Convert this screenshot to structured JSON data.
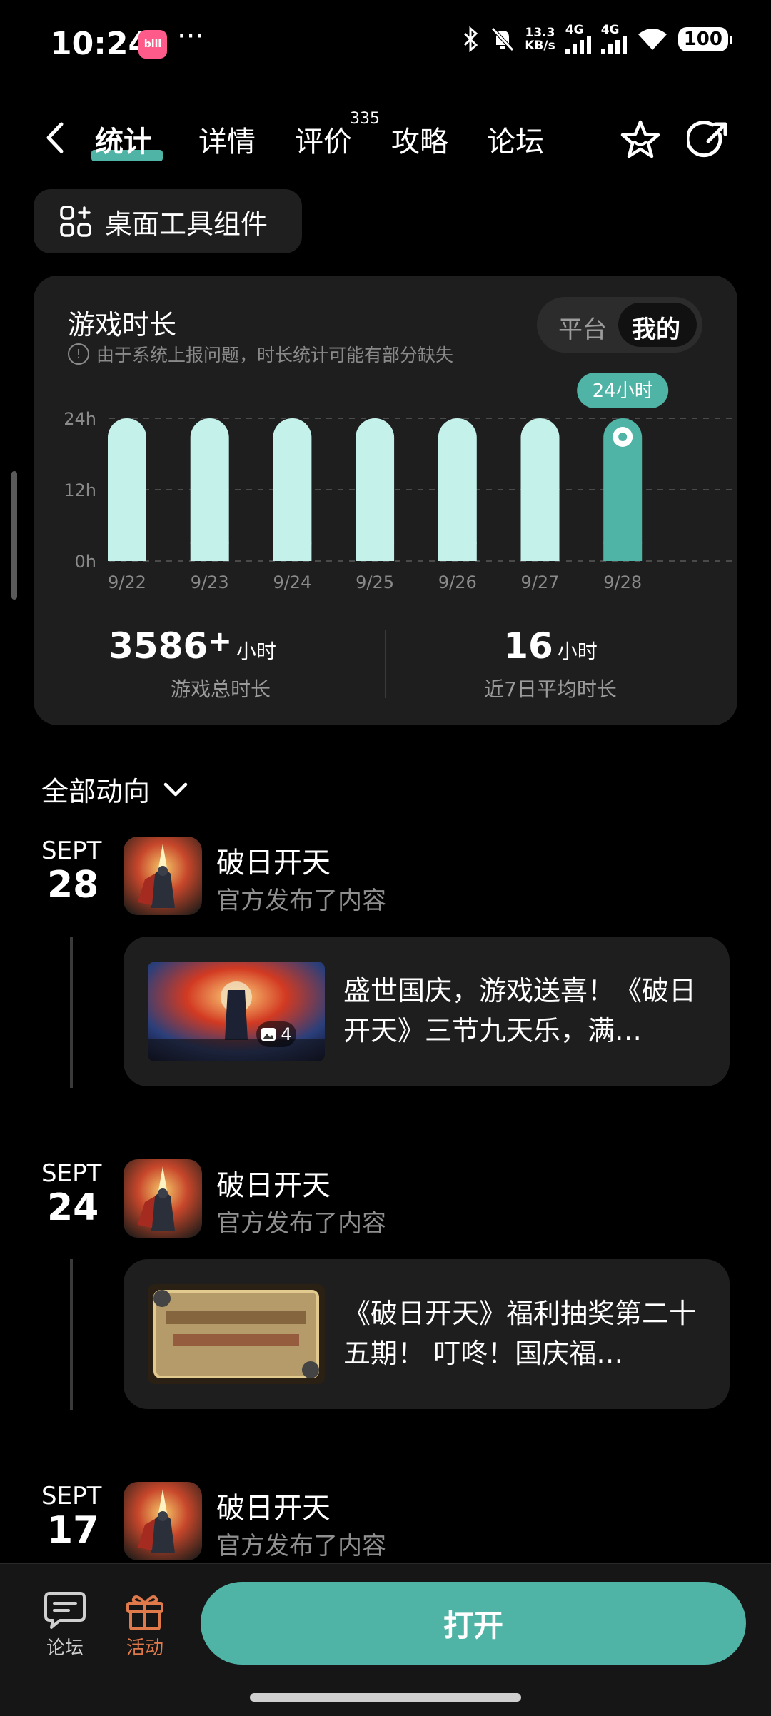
{
  "status_bar": {
    "time": "10:24",
    "app_badge": "bili",
    "more": "···",
    "net_speed_value": "13.3",
    "net_speed_unit": "KB/s",
    "sim1": "4G",
    "sim2": "4G",
    "battery": "100"
  },
  "nav": {
    "tabs": [
      {
        "label": "统计"
      },
      {
        "label": "详情"
      },
      {
        "label": "评价"
      },
      {
        "label": "攻略"
      },
      {
        "label": "论坛"
      }
    ],
    "review_count": "335",
    "icons": [
      "back-arrow-icon",
      "star-icon",
      "share-icon"
    ]
  },
  "widget_button": {
    "label": "桌面工具组件",
    "icon": "grid-plus-icon"
  },
  "playtime": {
    "title": "游戏时长",
    "note": "由于系统上报问题，时长统计可能有部分缺失",
    "toggle": {
      "platform": "平台",
      "mine": "我的"
    },
    "total_value": "3586",
    "total_plus": "+",
    "total_unit": "小时",
    "total_label": "游戏总时长",
    "avg_value": "16",
    "avg_unit": "小时",
    "avg_label": "近7日平均时长"
  },
  "chart_data": {
    "type": "bar",
    "categories": [
      "9/22",
      "9/23",
      "9/24",
      "9/25",
      "9/26",
      "9/27",
      "9/28"
    ],
    "values": [
      24,
      24,
      24,
      24,
      24,
      24,
      24
    ],
    "ylim": [
      0,
      24
    ],
    "y_ticks": [
      "24h",
      "12h",
      "0h"
    ],
    "highlight_index": 6,
    "highlight_label": "24小时",
    "bar_color": "#c4f1ea",
    "highlight_color": "#4fb3a5",
    "grid": true
  },
  "feed": {
    "header": "全部动向",
    "items": [
      {
        "month": "SEPT",
        "day": "28",
        "name": "破日开天",
        "subtitle": "官方发布了内容",
        "card_text": "盛世国庆，游戏送喜！《破日开天》三节九天乐，满…",
        "image_count": "4"
      },
      {
        "month": "SEPT",
        "day": "24",
        "name": "破日开天",
        "subtitle": "官方发布了内容",
        "card_text": "《破日开天》福利抽奖第二十五期！ 叮咚！国庆福…"
      },
      {
        "month": "SEPT",
        "day": "17",
        "name": "破日开天",
        "subtitle": "官方发布了内容"
      }
    ]
  },
  "bottom_bar": {
    "forum_label": "论坛",
    "activity_label": "活动",
    "open_label": "打开",
    "accent": "#4fb3a5",
    "activity_color": "#e07a4a"
  }
}
